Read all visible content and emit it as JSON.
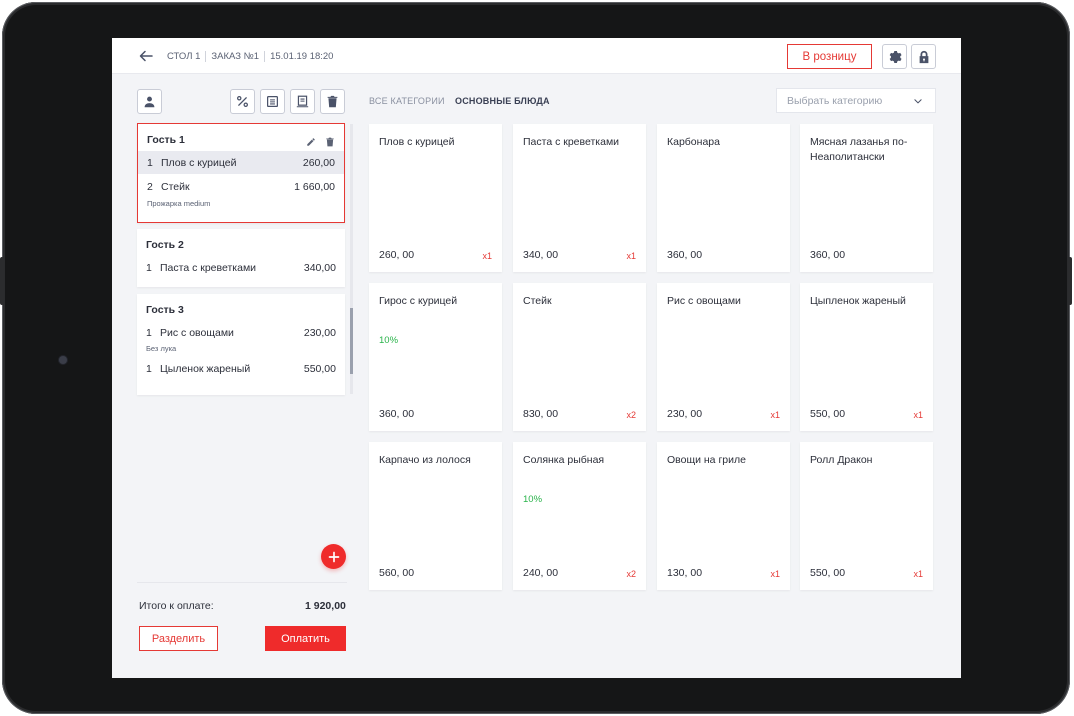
{
  "header": {
    "table": "СТОЛ 1",
    "order": "ЗАКАЗ №1",
    "datetime": "15.01.19 18:20",
    "retail_label": "В розницу"
  },
  "guests": [
    {
      "title": "Гость 1",
      "items": [
        {
          "qty": "1",
          "name": "Плов с курицей",
          "price": "260,00",
          "note": ""
        },
        {
          "qty": "2",
          "name": "Стейк",
          "price": "1 660,00",
          "note": "Прожарка medium"
        }
      ]
    },
    {
      "title": "Гость 2",
      "items": [
        {
          "qty": "1",
          "name": "Паста с креветками",
          "price": "340,00",
          "note": ""
        }
      ]
    },
    {
      "title": "Гость 3",
      "items": [
        {
          "qty": "1",
          "name": "Рис с овощами",
          "price": "230,00",
          "note": "Без лука"
        },
        {
          "qty": "1",
          "name": "Цыленок жареный",
          "price": "550,00",
          "note": ""
        }
      ]
    }
  ],
  "summary": {
    "total_label": "Итого к оплате:",
    "total_value": "1 920,00",
    "split_label": "Разделить",
    "pay_label": "Оплатить"
  },
  "categories": {
    "all": "ВСЕ КАТЕГОРИИ",
    "current": "ОСНОВНЫЕ БЛЮДА",
    "select_placeholder": "Выбрать категорию"
  },
  "dishes": [
    {
      "name": "Плов с курицей",
      "price": "260, 00",
      "qty": "x1",
      "discount": ""
    },
    {
      "name": "Паста с креветками",
      "price": "340, 00",
      "qty": "x1",
      "discount": ""
    },
    {
      "name": "Карбонара",
      "price": "360, 00",
      "qty": "",
      "discount": ""
    },
    {
      "name": "Мясная лазанья по-Неаполитански",
      "price": "360, 00",
      "qty": "",
      "discount": ""
    },
    {
      "name": "Гирос с курицей",
      "price": "360, 00",
      "qty": "",
      "discount": "10%"
    },
    {
      "name": "Стейк",
      "price": "830, 00",
      "qty": "x2",
      "discount": ""
    },
    {
      "name": "Рис с овощами",
      "price": "230, 00",
      "qty": "x1",
      "discount": ""
    },
    {
      "name": "Цыпленок жареный",
      "price": "550, 00",
      "qty": "x1",
      "discount": ""
    },
    {
      "name": "Карпачо из лолося",
      "price": "560, 00",
      "qty": "",
      "discount": ""
    },
    {
      "name": "Солянка рыбная",
      "price": "240, 00",
      "qty": "x2",
      "discount": "10%"
    },
    {
      "name": "Овощи на гриле",
      "price": "130, 00",
      "qty": "x1",
      "discount": ""
    },
    {
      "name": "Ролл Дракон",
      "price": "550, 00",
      "qty": "x1",
      "discount": ""
    }
  ],
  "icons": {
    "back": "arrow-left-icon",
    "settings": "gear-icon",
    "lock": "lock-icon",
    "guest": "person-icon",
    "discount": "percent-icon",
    "receipt": "receipt-icon",
    "print": "print-receipt-icon",
    "trash": "trash-icon",
    "edit": "pencil-icon",
    "add": "plus-icon",
    "dropdown": "chevron-down-icon"
  },
  "colors": {
    "accent": "#ef2b2b",
    "discount": "#29b34a",
    "background": "#f3f4f7"
  }
}
